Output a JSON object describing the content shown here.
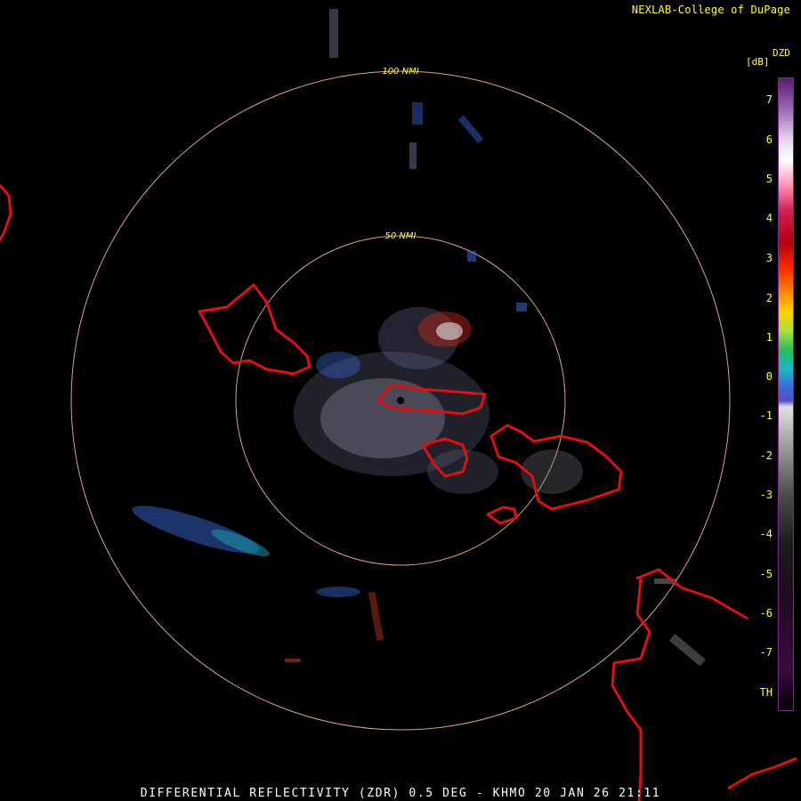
{
  "header": {
    "credit": "NEXLAB-College of DuPage"
  },
  "footer": {
    "caption": "DIFFERENTIAL REFLECTIVITY (ZDR) 0.5 DEG - KHMO 20 JAN 26 21:11"
  },
  "range_rings": [
    {
      "label": "100 NMI"
    },
    {
      "label": "50 NMI"
    }
  ],
  "color_scale": {
    "product": "DZD",
    "unit": "[dB]",
    "ticks": [
      "7",
      "6",
      "5",
      "4",
      "3",
      "2",
      "1",
      "0",
      "-1",
      "-2",
      "-3",
      "-4",
      "-5",
      "-6",
      "-7",
      "TH"
    ]
  },
  "colors": {
    "ring": "#d8a48a",
    "boundary": "#e01010",
    "label": "#ffff33",
    "caption": "#ffffff"
  }
}
